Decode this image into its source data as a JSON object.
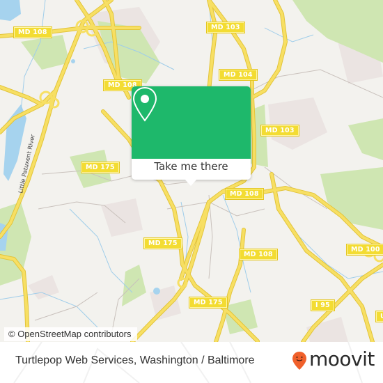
{
  "map": {
    "road_labels": [
      {
        "id": "md108-nw",
        "text": "MD 108"
      },
      {
        "id": "md103-n",
        "text": "MD 103"
      },
      {
        "id": "md108-n",
        "text": "MD 108"
      },
      {
        "id": "md104",
        "text": "MD 104"
      },
      {
        "id": "md103-e",
        "text": "MD 103"
      },
      {
        "id": "md175-w",
        "text": "MD 175"
      },
      {
        "id": "md108-c",
        "text": "MD 108"
      },
      {
        "id": "md175-c",
        "text": "MD 175"
      },
      {
        "id": "md108-s",
        "text": "MD 108"
      },
      {
        "id": "md100",
        "text": "MD 100"
      },
      {
        "id": "md175-s",
        "text": "MD 175"
      },
      {
        "id": "i95",
        "text": "I 95"
      },
      {
        "id": "us-partial",
        "text": "U"
      }
    ],
    "river_label": "Little Patuxent River",
    "attribution": "© OpenStreetMap contributors",
    "colors": {
      "land": "#f3f2ee",
      "road": "#f6dd5a",
      "road_casing": "#e2c43a",
      "water": "#a6d3ee",
      "park": "#cfe6b2",
      "residential": "#ebe4e2"
    }
  },
  "popup": {
    "button_label": "Take me there",
    "icon": "map-pin-icon",
    "accent_color": "#1eb86b"
  },
  "footer": {
    "title": "Turtlepop Web Services, Washington / Baltimore",
    "brand": "moovit",
    "brand_icon": "moovit-pin-icon",
    "brand_color": "#f0602b"
  }
}
